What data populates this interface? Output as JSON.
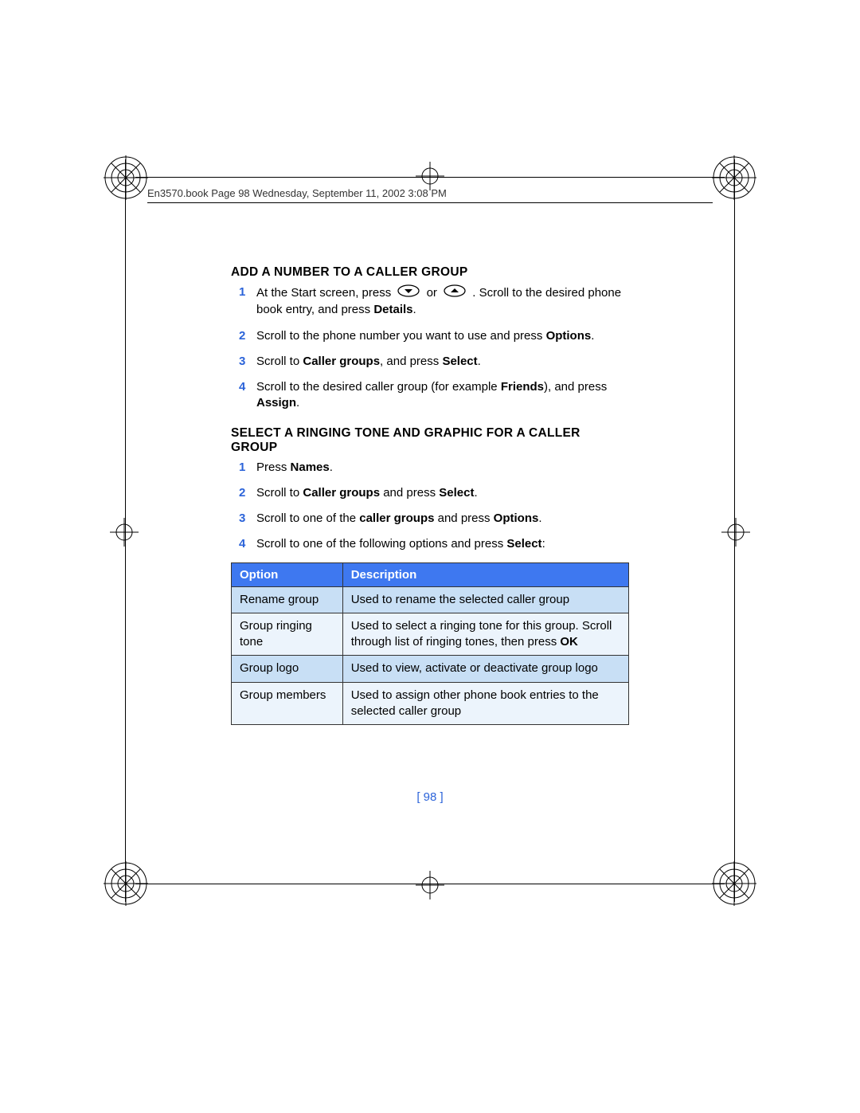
{
  "header": "En3570.book  Page 98  Wednesday, September 11, 2002  3:08 PM",
  "section1": {
    "heading": "ADD A NUMBER TO A CALLER GROUP",
    "steps": [
      {
        "num": "1",
        "pre": "At the Start screen, press  ",
        "mid": "  or  ",
        "post": " . Scroll to the desired phone book entry, and press ",
        "bold1": "Details",
        "tail": "."
      },
      {
        "num": "2",
        "text": "Scroll to the phone number you want to use and press ",
        "bold": "Options",
        "tail": "."
      },
      {
        "num": "3",
        "pre": "Scroll to ",
        "bold1": "Caller groups",
        "mid": ", and press ",
        "bold2": "Select",
        "tail": "."
      },
      {
        "num": "4",
        "pre": "Scroll to the desired caller group (for example ",
        "bold1": "Friends",
        "mid": "), and press ",
        "bold2": "Assign",
        "tail": "."
      }
    ]
  },
  "section2": {
    "heading": "SELECT A RINGING TONE AND GRAPHIC FOR A CALLER GROUP",
    "steps": [
      {
        "num": "1",
        "pre": "Press ",
        "bold1": "Names",
        "tail": "."
      },
      {
        "num": "2",
        "pre": "Scroll to ",
        "bold1": "Caller groups",
        "mid": " and press ",
        "bold2": "Select",
        "tail": "."
      },
      {
        "num": "3",
        "pre": "Scroll to one of the ",
        "bold1": "caller groups",
        "mid": " and press ",
        "bold2": "Options",
        "tail": "."
      },
      {
        "num": "4",
        "pre": "Scroll to one of the following options and press ",
        "bold1": "Select",
        "tail": ":"
      }
    ]
  },
  "table": {
    "headers": {
      "col1": "Option",
      "col2": "Description"
    },
    "rows": [
      {
        "opt": "Rename group",
        "desc": "Used to rename the selected caller group"
      },
      {
        "opt": "Group ringing tone",
        "descPre": "Used to select a ringing tone for this group. Scroll through list of ringing tones, then press ",
        "descBold": "OK"
      },
      {
        "opt": "Group logo",
        "desc": "Used to view, activate or deactivate group logo"
      },
      {
        "opt": "Group members",
        "desc": "Used to assign other phone book entries to the selected caller group"
      }
    ]
  },
  "pageNumber": "[ 98 ]"
}
